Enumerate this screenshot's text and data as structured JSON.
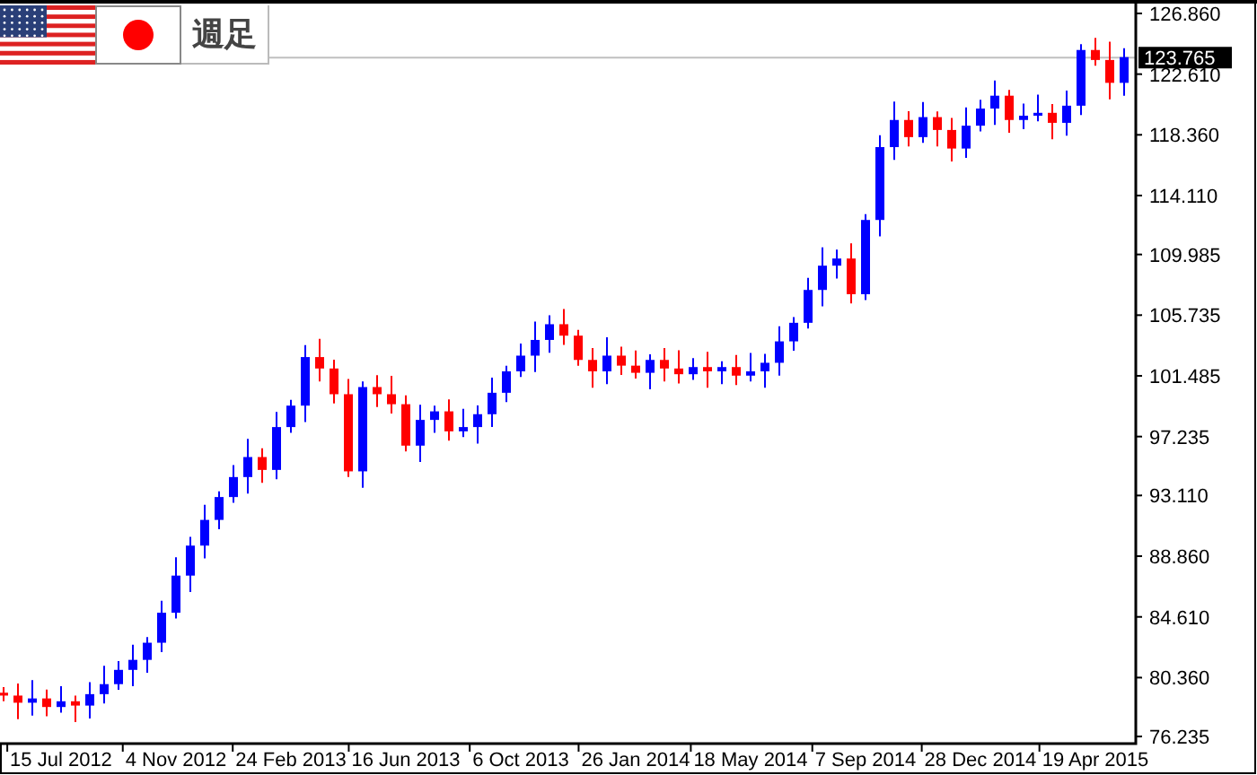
{
  "header": {
    "title": "週足"
  },
  "chart": {
    "current_price": "123.765",
    "chart_data": {
      "type": "candlestick",
      "categories": [
        null,
        null,
        null,
        null,
        "15 Jul 2012",
        null,
        null,
        null,
        null,
        null,
        null,
        null,
        "4 Nov 2012",
        null,
        null,
        null,
        null,
        null,
        null,
        null,
        "24 Feb 2013",
        null,
        null,
        null,
        null,
        null,
        null,
        null,
        "16 Jun 2013",
        null,
        null,
        null,
        null,
        null,
        null,
        null,
        "6 Oct 2013",
        null,
        null,
        null,
        null,
        null,
        null,
        null,
        "26 Jan 2014",
        null,
        null,
        null,
        null,
        null,
        null,
        null,
        "18 May 2014",
        null,
        null,
        null,
        null,
        null,
        null,
        null,
        "7 Sep 2014",
        null,
        null,
        null,
        null,
        null,
        null,
        null,
        "28 Dec 2014",
        null,
        null,
        null,
        null,
        null,
        null,
        null,
        "19 Apr 2015",
        null,
        null
      ],
      "ohlc": [
        [
          79.3,
          79.7,
          78.7,
          79.1
        ],
        [
          79.1,
          79.94,
          77.45,
          78.6
        ],
        [
          78.6,
          80.18,
          77.7,
          78.9
        ],
        [
          78.9,
          79.52,
          77.65,
          78.3
        ],
        [
          78.3,
          79.76,
          77.9,
          78.7
        ],
        [
          78.7,
          79.1,
          77.25,
          78.4
        ],
        [
          78.4,
          80.04,
          77.5,
          79.2
        ],
        [
          79.2,
          81.18,
          78.55,
          79.9
        ],
        [
          79.9,
          81.52,
          79.5,
          80.9
        ],
        [
          80.9,
          82.66,
          79.75,
          81.6
        ],
        [
          81.6,
          83.2,
          80.7,
          82.8
        ],
        [
          82.8,
          85.74,
          82.15,
          84.9
        ],
        [
          84.9,
          88.78,
          84.5,
          87.5
        ],
        [
          87.5,
          90.22,
          86.35,
          89.6
        ],
        [
          89.6,
          92.46,
          88.7,
          91.4
        ],
        [
          91.4,
          93.4,
          90.75,
          93.0
        ],
        [
          93.0,
          95.24,
          92.6,
          94.4
        ],
        [
          94.4,
          97.08,
          93.25,
          95.8
        ],
        [
          95.8,
          96.42,
          94.0,
          94.9
        ],
        [
          94.9,
          98.96,
          94.25,
          97.9
        ],
        [
          97.9,
          99.8,
          97.5,
          99.4
        ],
        [
          99.4,
          103.64,
          98.25,
          102.8
        ],
        [
          102.8,
          104.08,
          101.1,
          102.0
        ],
        [
          102.0,
          102.62,
          99.55,
          100.2
        ],
        [
          100.2,
          101.26,
          94.4,
          94.8
        ],
        [
          94.8,
          101.1,
          93.65,
          100.7
        ],
        [
          100.7,
          101.54,
          99.3,
          100.2
        ],
        [
          100.2,
          101.48,
          98.85,
          99.5
        ],
        [
          99.5,
          100.12,
          96.2,
          96.6
        ],
        [
          96.6,
          99.46,
          95.45,
          98.4
        ],
        [
          98.4,
          99.4,
          97.5,
          99.0
        ],
        [
          99.0,
          99.84,
          96.95,
          97.6
        ],
        [
          97.6,
          99.18,
          97.2,
          97.9
        ],
        [
          97.9,
          99.42,
          96.75,
          98.8
        ],
        [
          98.8,
          101.36,
          97.9,
          100.3
        ],
        [
          100.3,
          102.2,
          99.65,
          101.8
        ],
        [
          101.8,
          103.74,
          101.4,
          102.9
        ],
        [
          102.9,
          105.28,
          101.75,
          104.0
        ],
        [
          104.0,
          105.72,
          103.1,
          105.1
        ],
        [
          105.1,
          106.16,
          103.65,
          104.3
        ],
        [
          104.3,
          104.7,
          102.2,
          102.6
        ],
        [
          102.6,
          103.44,
          100.65,
          101.8
        ],
        [
          101.8,
          104.18,
          100.9,
          102.9
        ],
        [
          102.9,
          103.52,
          101.55,
          102.2
        ],
        [
          102.2,
          103.26,
          101.3,
          101.7
        ],
        [
          101.7,
          103.0,
          100.55,
          102.6
        ],
        [
          102.6,
          103.44,
          101.1,
          102.0
        ],
        [
          102.0,
          103.28,
          100.95,
          101.6
        ],
        [
          101.6,
          102.72,
          101.2,
          102.1
        ],
        [
          102.1,
          103.16,
          100.65,
          101.8
        ],
        [
          101.8,
          102.5,
          100.9,
          102.1
        ],
        [
          102.1,
          102.94,
          100.85,
          101.5
        ],
        [
          101.5,
          103.08,
          101.1,
          101.8
        ],
        [
          101.8,
          103.02,
          100.65,
          102.4
        ],
        [
          102.4,
          104.96,
          101.5,
          103.9
        ],
        [
          103.9,
          105.6,
          103.25,
          105.2
        ],
        [
          105.2,
          108.34,
          104.8,
          107.5
        ],
        [
          107.5,
          110.48,
          106.35,
          109.2
        ],
        [
          109.2,
          110.32,
          108.3,
          109.7
        ],
        [
          109.7,
          110.76,
          106.55,
          107.2
        ],
        [
          107.2,
          112.8,
          106.8,
          112.4
        ],
        [
          112.4,
          118.34,
          111.25,
          117.5
        ],
        [
          117.5,
          120.68,
          116.6,
          119.4
        ],
        [
          119.4,
          120.02,
          117.55,
          118.2
        ],
        [
          118.2,
          120.66,
          117.8,
          119.6
        ],
        [
          119.6,
          120.0,
          117.55,
          118.7
        ],
        [
          118.7,
          119.54,
          116.5,
          117.4
        ],
        [
          117.4,
          120.28,
          116.75,
          119.0
        ],
        [
          119.0,
          120.82,
          118.6,
          120.2
        ],
        [
          120.2,
          122.16,
          119.05,
          121.1
        ],
        [
          121.1,
          121.5,
          118.5,
          119.4
        ],
        [
          119.4,
          120.54,
          118.75,
          119.7
        ],
        [
          119.7,
          121.18,
          119.3,
          119.9
        ],
        [
          119.9,
          120.52,
          118.05,
          119.2
        ],
        [
          119.2,
          121.46,
          118.3,
          120.4
        ],
        [
          120.4,
          124.7,
          119.75,
          124.3
        ],
        [
          124.3,
          125.14,
          123.2,
          123.6
        ],
        [
          123.6,
          124.88,
          120.85,
          122.0
        ],
        [
          122.0,
          124.42,
          121.1,
          123.8
        ]
      ],
      "ylim": [
        75.8,
        127.8
      ],
      "yticks": [
        {
          "value": 126.86,
          "label": "126.860"
        },
        {
          "value": 122.61,
          "label": "122.610"
        },
        {
          "value": 118.36,
          "label": "118.360"
        },
        {
          "value": 114.11,
          "label": "114.110"
        },
        {
          "value": 109.985,
          "label": "109.985"
        },
        {
          "value": 105.735,
          "label": "105.735"
        },
        {
          "value": 101.485,
          "label": "101.485"
        },
        {
          "value": 97.235,
          "label": "97.235"
        },
        {
          "value": 93.11,
          "label": "93.110"
        },
        {
          "value": 88.86,
          "label": "88.860"
        },
        {
          "value": 84.61,
          "label": "84.610"
        },
        {
          "value": 80.36,
          "label": "80.360"
        },
        {
          "value": 76.235,
          "label": "76.235"
        }
      ]
    }
  }
}
